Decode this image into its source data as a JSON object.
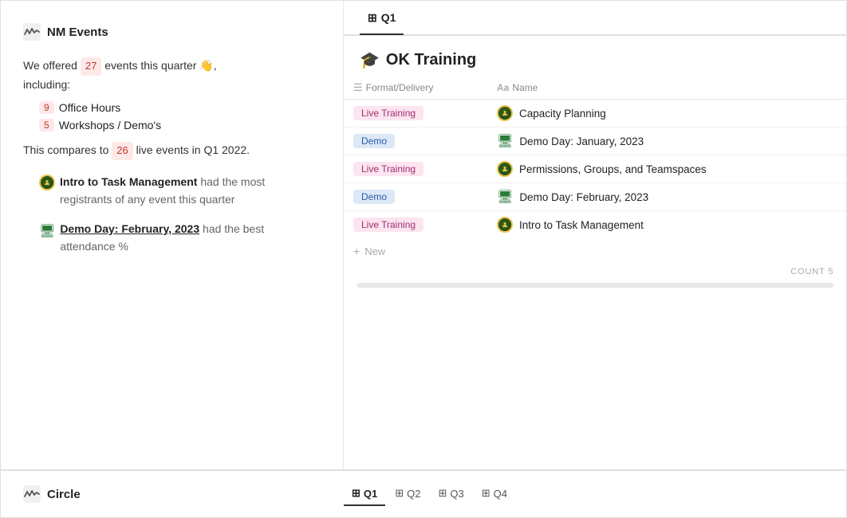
{
  "app": {
    "title": "NM Events"
  },
  "left": {
    "intro": "We offered",
    "events_count": "27",
    "intro2": "events this quarter 👋,",
    "including": "including:",
    "bullets": [
      {
        "count": "9",
        "label": "Office Hours"
      },
      {
        "count": "5",
        "label": "Workshops / Demo's"
      }
    ],
    "compare_prefix": "This compares to",
    "compare_count": "26",
    "compare_suffix": "live events in Q1 2022.",
    "highlights": [
      {
        "icon": "nm-avatar",
        "bold": "Intro to Task Management",
        "rest": " had the most registrants of any event this quarter"
      },
      {
        "icon": "monitor",
        "bold": "Demo Day: February, 2023",
        "rest": " had the best attendance %"
      }
    ]
  },
  "right": {
    "tabs": [
      {
        "label": "Q1",
        "active": true
      }
    ],
    "section": {
      "emoji": "🎓",
      "title": "OK Training"
    },
    "columns": [
      {
        "icon": "list-icon",
        "label": "Format/Delivery"
      },
      {
        "icon": "text-icon",
        "label": "Name"
      }
    ],
    "rows": [
      {
        "tag": "Live Training",
        "tag_type": "pink",
        "name_icon": "nm-avatar",
        "name": "Capacity Planning"
      },
      {
        "tag": "Demo",
        "tag_type": "blue",
        "name_icon": "monitor",
        "name": "Demo Day: January, 2023"
      },
      {
        "tag": "Live Training",
        "tag_type": "pink",
        "name_icon": "nm-avatar",
        "name": "Permissions, Groups, and Teamspaces"
      },
      {
        "tag": "Demo",
        "tag_type": "blue",
        "name_icon": "monitor",
        "name": "Demo Day: February, 2023"
      },
      {
        "tag": "Live Training",
        "tag_type": "pink",
        "name_icon": "nm-avatar",
        "name": "Intro to Task Management"
      }
    ],
    "new_label": "New",
    "count_label": "COUNT",
    "count": "5"
  },
  "bottom": {
    "left_icon": "wave-icon",
    "left_title": "Circle",
    "tabs": [
      {
        "label": "Q1",
        "active": true
      },
      {
        "label": "Q2",
        "active": false
      },
      {
        "label": "Q3",
        "active": false
      },
      {
        "label": "Q4",
        "active": false
      }
    ]
  }
}
